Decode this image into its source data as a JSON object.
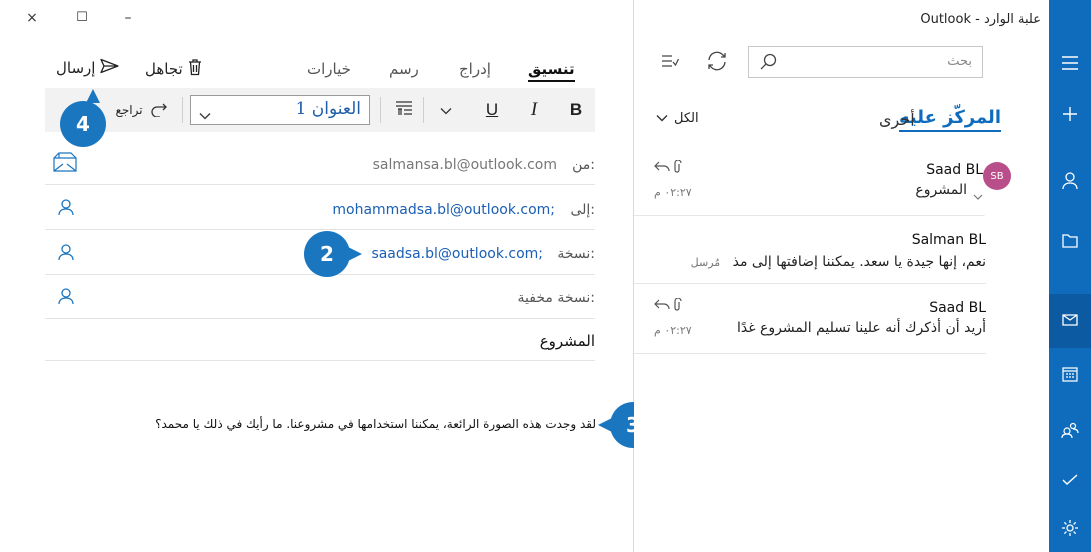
{
  "window": {
    "title": "علبة الوارد - Outlook",
    "close_glyph": "×",
    "maximize_glyph": "☐",
    "minimize_glyph": "–"
  },
  "compose": {
    "tabs": [
      {
        "label": "تنسيق",
        "active": true
      },
      {
        "label": "إدراج",
        "active": false
      },
      {
        "label": "رسم",
        "active": false
      },
      {
        "label": "خيارات",
        "active": false
      }
    ],
    "discard_label": "تجاهل",
    "send_label": "إرسال",
    "toolbar": {
      "bold": "B",
      "italic": "I",
      "underline": "U",
      "style_value": "العنوان 1",
      "undo_label": "تراجع"
    },
    "fields": {
      "from_label": "من:",
      "from_value": "salmansa.bl@outlook.com",
      "to_label": "إلى:",
      "to_value": "mohammadsa.bl@outlook.com;",
      "cc_label": "نسخة:",
      "cc_value": "saadsa.bl@outlook.com;",
      "bcc_label": "نسخة مخفية:",
      "subject_value": "المشروع"
    },
    "body_text": "لقد وجدت هذه الصورة الرائعة، يمكننا استخدامها في مشروعنا. ما رأيك في ذلك يا محمد؟"
  },
  "callouts": {
    "badge_2": "2",
    "badge_3": "3",
    "badge_4": "4"
  },
  "inbox": {
    "search_placeholder": "بحث",
    "focused_tab": "المركّز عليه",
    "other_tab": "أخرى",
    "filter_label": "الكل",
    "messages": [
      {
        "sender": "Saad BL",
        "avatar": "SB",
        "subject": "المشروع",
        "time": "٠٢:٢٧ م",
        "preview": ""
      },
      {
        "sender": "Salman BL",
        "subject": "نعم، إنها جيدة يا سعد. يمكننا إضافتها إلى مذ",
        "draft": "مُرسل",
        "time": ""
      },
      {
        "sender": "Saad BL",
        "subject": "أريد أن أذكرك أنه علينا تسليم المشروع غدًا",
        "time": "٠٢:٢٧ م"
      }
    ]
  },
  "colors": {
    "accent": "#0f6cbd",
    "badge": "#1b76c0",
    "avatar": "#b94f8a"
  }
}
